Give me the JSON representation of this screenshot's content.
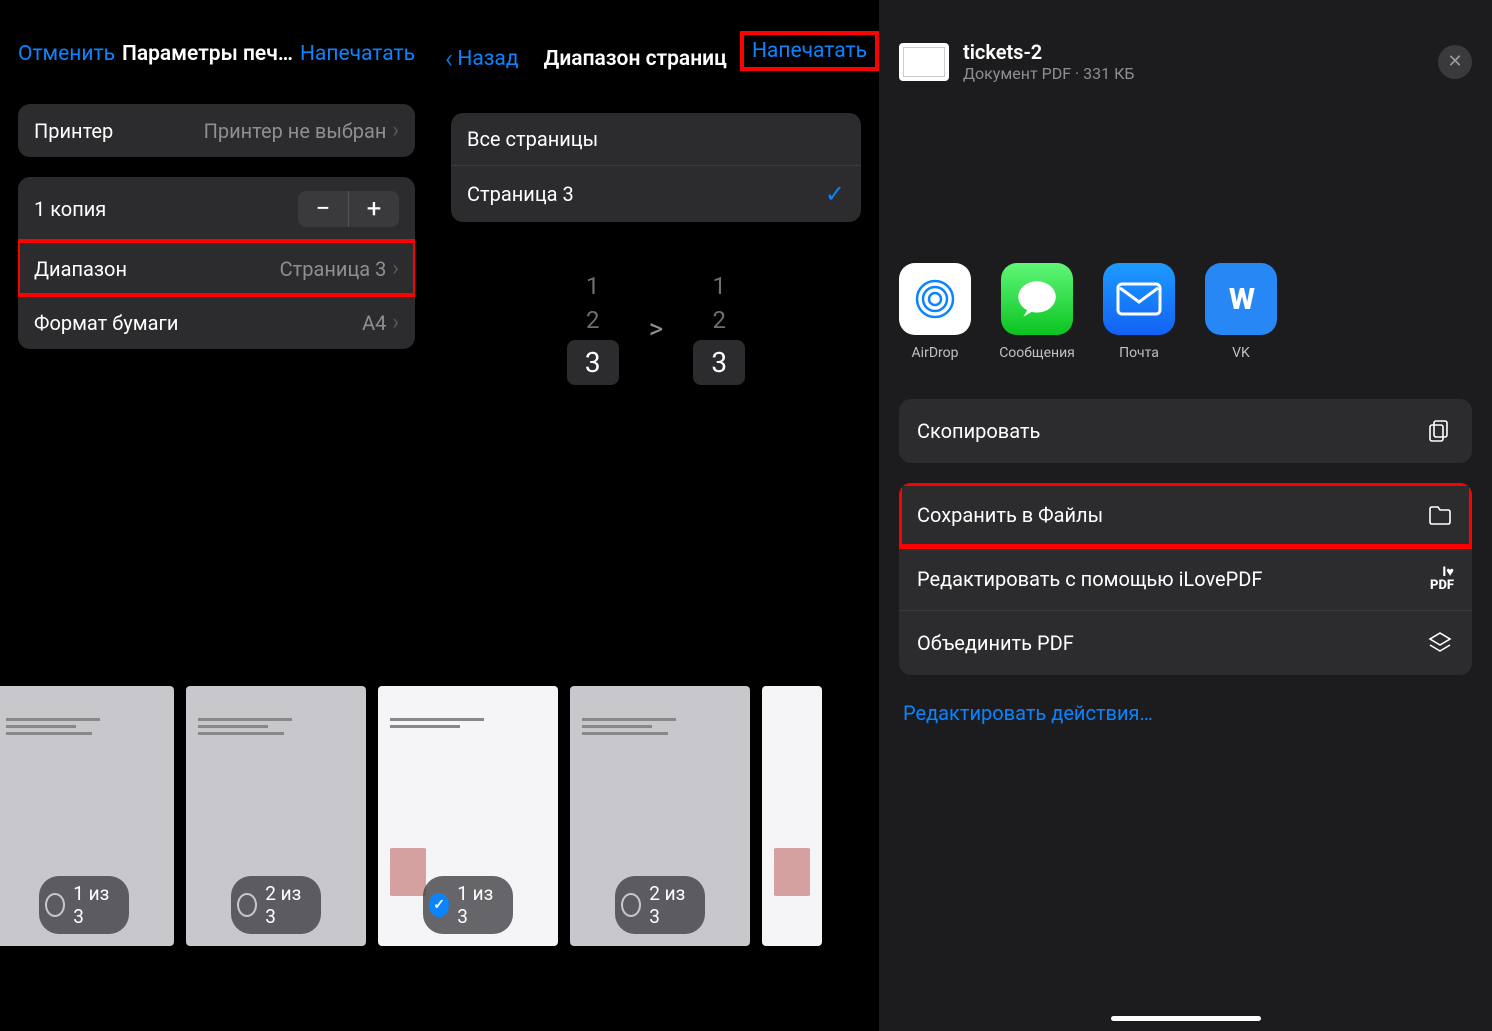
{
  "panel1": {
    "cancel": "Отменить",
    "title": "Параметры печ…",
    "print": "Напечатать",
    "printer_label": "Принтер",
    "printer_value": "Принтер не выбран",
    "copies_label": "1 копия",
    "range_label": "Диапазон",
    "range_value": "Страница 3",
    "paper_label": "Формат бумаги",
    "paper_value": "A4"
  },
  "panel2": {
    "back": "Назад",
    "title": "Диапазон страниц",
    "print": "Напечатать",
    "all_pages": "Все страницы",
    "page3": "Страница 3",
    "picker": {
      "col1": [
        "1",
        "2",
        "3"
      ],
      "col2": [
        "1",
        "2",
        "3"
      ],
      "arrow": ">"
    }
  },
  "thumbs": [
    {
      "label": "1 из 3",
      "checked": false
    },
    {
      "label": "2 из 3",
      "checked": false
    },
    {
      "label": "1 из 3",
      "checked": true
    },
    {
      "label": "2 из 3",
      "checked": false
    }
  ],
  "panel3": {
    "file_name": "tickets-2",
    "file_meta": "Документ PDF · 331 КБ",
    "apps": [
      {
        "id": "airdrop",
        "label": "AirDrop"
      },
      {
        "id": "messages",
        "label": "Сообщения"
      },
      {
        "id": "mail",
        "label": "Почта"
      },
      {
        "id": "vk",
        "label": "VK"
      }
    ],
    "actions": {
      "copy": "Скопировать",
      "save_files": "Сохранить в Файлы",
      "edit_ilovepdf": "Редактировать с помощью iLovePDF",
      "merge_pdf": "Объединить PDF"
    },
    "edit_actions": "Редактировать действия…"
  }
}
